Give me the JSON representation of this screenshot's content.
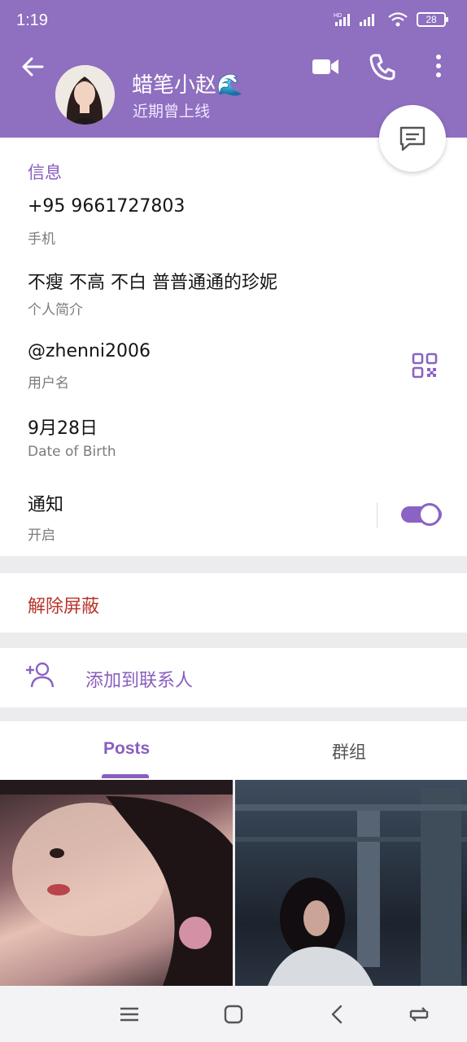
{
  "status_bar": {
    "time": "1:19",
    "network_label": "HD",
    "battery": "28"
  },
  "header": {
    "name": "蜡笔小赵",
    "name_emoji": "🌊",
    "presence": "近期曾上线"
  },
  "info": {
    "section_title": "信息",
    "phone_value": "+95 9661727803",
    "phone_label": "手机",
    "bio_value": "不瘦 不高 不白 普普通通的珍妮",
    "bio_label": "个人简介",
    "username_value": "@zhenni2006",
    "username_label": "用户名",
    "birthday_value": "9月28日",
    "birthday_label": "Date of Birth",
    "notify_value": "通知",
    "notify_label": "开启",
    "notifications_on": true
  },
  "actions": {
    "unblock": "解除屏蔽",
    "add_contact": "添加到联系人"
  },
  "tabs": [
    {
      "label": "Posts",
      "active": true
    },
    {
      "label": "群组",
      "active": false
    }
  ],
  "colors": {
    "accent": "#8f6fc0",
    "danger": "#b8342b"
  }
}
